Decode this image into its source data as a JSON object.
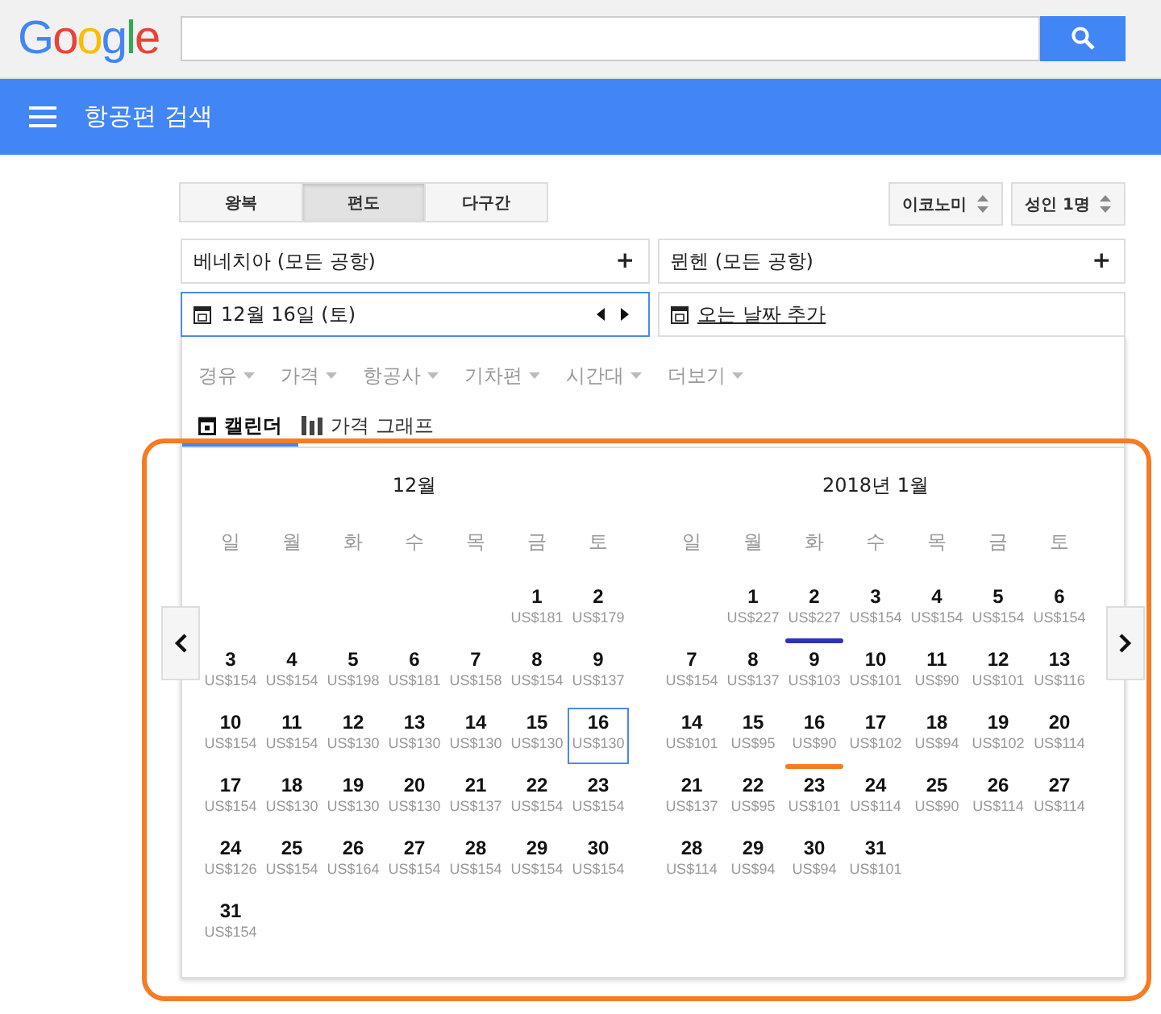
{
  "header": {
    "logo": "Google"
  },
  "app_bar": {
    "title": "항공편 검색"
  },
  "trip_types": [
    {
      "label": "왕복",
      "selected": false
    },
    {
      "label": "편도",
      "selected": true
    },
    {
      "label": "다구간",
      "selected": false
    }
  ],
  "cabin": "이코노미",
  "passengers": "성인 1명",
  "origin": {
    "value": "베네치아 (모든 공항)",
    "action": "+"
  },
  "destination": {
    "value": "뮌헨 (모든 공항)",
    "action": "+"
  },
  "depart_date": "12월 16일 (토)",
  "return_date": "오는 날짜 추가",
  "filters": [
    "경유",
    "가격",
    "항공사",
    "기차편",
    "시간대",
    "더보기"
  ],
  "view_tabs": [
    {
      "label": "캘린더",
      "kind": "calendar",
      "selected": true
    },
    {
      "label": "가격 그래프",
      "kind": "graph",
      "selected": false
    }
  ],
  "months": [
    {
      "title": "12월",
      "weekdays": [
        "일",
        "월",
        "화",
        "수",
        "목",
        "금",
        "토"
      ],
      "weeks": [
        [
          {
            "kind": "blank"
          },
          {
            "kind": "blank"
          },
          {
            "kind": "blank"
          },
          {
            "kind": "blank"
          },
          {
            "kind": "blank"
          },
          {
            "kind": "day",
            "day": "1",
            "price": "US$181",
            "selected": false
          },
          {
            "kind": "day",
            "day": "2",
            "price": "US$179",
            "selected": false
          }
        ],
        [
          {
            "kind": "day",
            "day": "3",
            "price": "US$154",
            "selected": false
          },
          {
            "kind": "day",
            "day": "4",
            "price": "US$154",
            "selected": false
          },
          {
            "kind": "day",
            "day": "5",
            "price": "US$198",
            "selected": false
          },
          {
            "kind": "day",
            "day": "6",
            "price": "US$181",
            "selected": false
          },
          {
            "kind": "day",
            "day": "7",
            "price": "US$158",
            "selected": false
          },
          {
            "kind": "day",
            "day": "8",
            "price": "US$154",
            "selected": false
          },
          {
            "kind": "day",
            "day": "9",
            "price": "US$137",
            "selected": false
          }
        ],
        [
          {
            "kind": "day",
            "day": "10",
            "price": "US$154",
            "selected": false
          },
          {
            "kind": "day",
            "day": "11",
            "price": "US$154",
            "selected": false
          },
          {
            "kind": "day",
            "day": "12",
            "price": "US$130",
            "selected": false
          },
          {
            "kind": "day",
            "day": "13",
            "price": "US$130",
            "selected": false
          },
          {
            "kind": "day",
            "day": "14",
            "price": "US$130",
            "selected": false
          },
          {
            "kind": "day",
            "day": "15",
            "price": "US$130",
            "selected": false
          },
          {
            "kind": "day",
            "day": "16",
            "price": "US$130",
            "selected": true
          }
        ],
        [
          {
            "kind": "day",
            "day": "17",
            "price": "US$154",
            "selected": false
          },
          {
            "kind": "day",
            "day": "18",
            "price": "US$130",
            "selected": false
          },
          {
            "kind": "day",
            "day": "19",
            "price": "US$130",
            "selected": false
          },
          {
            "kind": "day",
            "day": "20",
            "price": "US$130",
            "selected": false
          },
          {
            "kind": "day",
            "day": "21",
            "price": "US$137",
            "selected": false
          },
          {
            "kind": "day",
            "day": "22",
            "price": "US$154",
            "selected": false
          },
          {
            "kind": "day",
            "day": "23",
            "price": "US$154",
            "selected": false
          }
        ],
        [
          {
            "kind": "day",
            "day": "24",
            "price": "US$126",
            "selected": false
          },
          {
            "kind": "day",
            "day": "25",
            "price": "US$154",
            "selected": false
          },
          {
            "kind": "day",
            "day": "26",
            "price": "US$164",
            "selected": false
          },
          {
            "kind": "day",
            "day": "27",
            "price": "US$154",
            "selected": false
          },
          {
            "kind": "day",
            "day": "28",
            "price": "US$154",
            "selected": false
          },
          {
            "kind": "day",
            "day": "29",
            "price": "US$154",
            "selected": false
          },
          {
            "kind": "day",
            "day": "30",
            "price": "US$154",
            "selected": false
          }
        ],
        [
          {
            "kind": "day",
            "day": "31",
            "price": "US$154",
            "selected": false
          }
        ]
      ]
    },
    {
      "title": "2018년 1월",
      "weekdays": [
        "일",
        "월",
        "화",
        "수",
        "목",
        "금",
        "토"
      ],
      "weeks": [
        [
          {
            "kind": "blank"
          },
          {
            "kind": "day",
            "day": "1",
            "price": "US$227",
            "selected": false
          },
          {
            "kind": "day",
            "day": "2",
            "price": "US$227",
            "selected": false,
            "color": "#2b35b5"
          },
          {
            "kind": "day",
            "day": "3",
            "price": "US$154",
            "selected": false
          },
          {
            "kind": "day",
            "day": "4",
            "price": "US$154",
            "selected": false
          },
          {
            "kind": "day",
            "day": "5",
            "price": "US$154",
            "selected": false
          },
          {
            "kind": "day",
            "day": "6",
            "price": "US$154",
            "selected": false
          }
        ],
        [
          {
            "kind": "day",
            "day": "7",
            "price": "US$154",
            "selected": false
          },
          {
            "kind": "day",
            "day": "8",
            "price": "US$137",
            "selected": false
          },
          {
            "kind": "day",
            "day": "9",
            "price": "US$103",
            "selected": false
          },
          {
            "kind": "day",
            "day": "10",
            "price": "US$101",
            "selected": false
          },
          {
            "kind": "day",
            "day": "11",
            "price": "US$90",
            "selected": false
          },
          {
            "kind": "day",
            "day": "12",
            "price": "US$101",
            "selected": false
          },
          {
            "kind": "day",
            "day": "13",
            "price": "US$116",
            "selected": false
          }
        ],
        [
          {
            "kind": "day",
            "day": "14",
            "price": "US$101",
            "selected": false
          },
          {
            "kind": "day",
            "day": "15",
            "price": "US$95",
            "selected": false
          },
          {
            "kind": "day",
            "day": "16",
            "price": "US$90",
            "selected": false,
            "color": "#f57c22"
          },
          {
            "kind": "day",
            "day": "17",
            "price": "US$102",
            "selected": false
          },
          {
            "kind": "day",
            "day": "18",
            "price": "US$94",
            "selected": false
          },
          {
            "kind": "day",
            "day": "19",
            "price": "US$102",
            "selected": false
          },
          {
            "kind": "day",
            "day": "20",
            "price": "US$114",
            "selected": false
          }
        ],
        [
          {
            "kind": "day",
            "day": "21",
            "price": "US$137",
            "selected": false
          },
          {
            "kind": "day",
            "day": "22",
            "price": "US$95",
            "selected": false
          },
          {
            "kind": "day",
            "day": "23",
            "price": "US$101",
            "selected": false
          },
          {
            "kind": "day",
            "day": "24",
            "price": "US$114",
            "selected": false
          },
          {
            "kind": "day",
            "day": "25",
            "price": "US$90",
            "selected": false
          },
          {
            "kind": "day",
            "day": "26",
            "price": "US$114",
            "selected": false
          },
          {
            "kind": "day",
            "day": "27",
            "price": "US$114",
            "selected": false
          }
        ],
        [
          {
            "kind": "day",
            "day": "28",
            "price": "US$114",
            "selected": false
          },
          {
            "kind": "day",
            "day": "29",
            "price": "US$94",
            "selected": false
          },
          {
            "kind": "day",
            "day": "30",
            "price": "US$94",
            "selected": false
          },
          {
            "kind": "day",
            "day": "31",
            "price": "US$101",
            "selected": false
          }
        ]
      ]
    }
  ]
}
